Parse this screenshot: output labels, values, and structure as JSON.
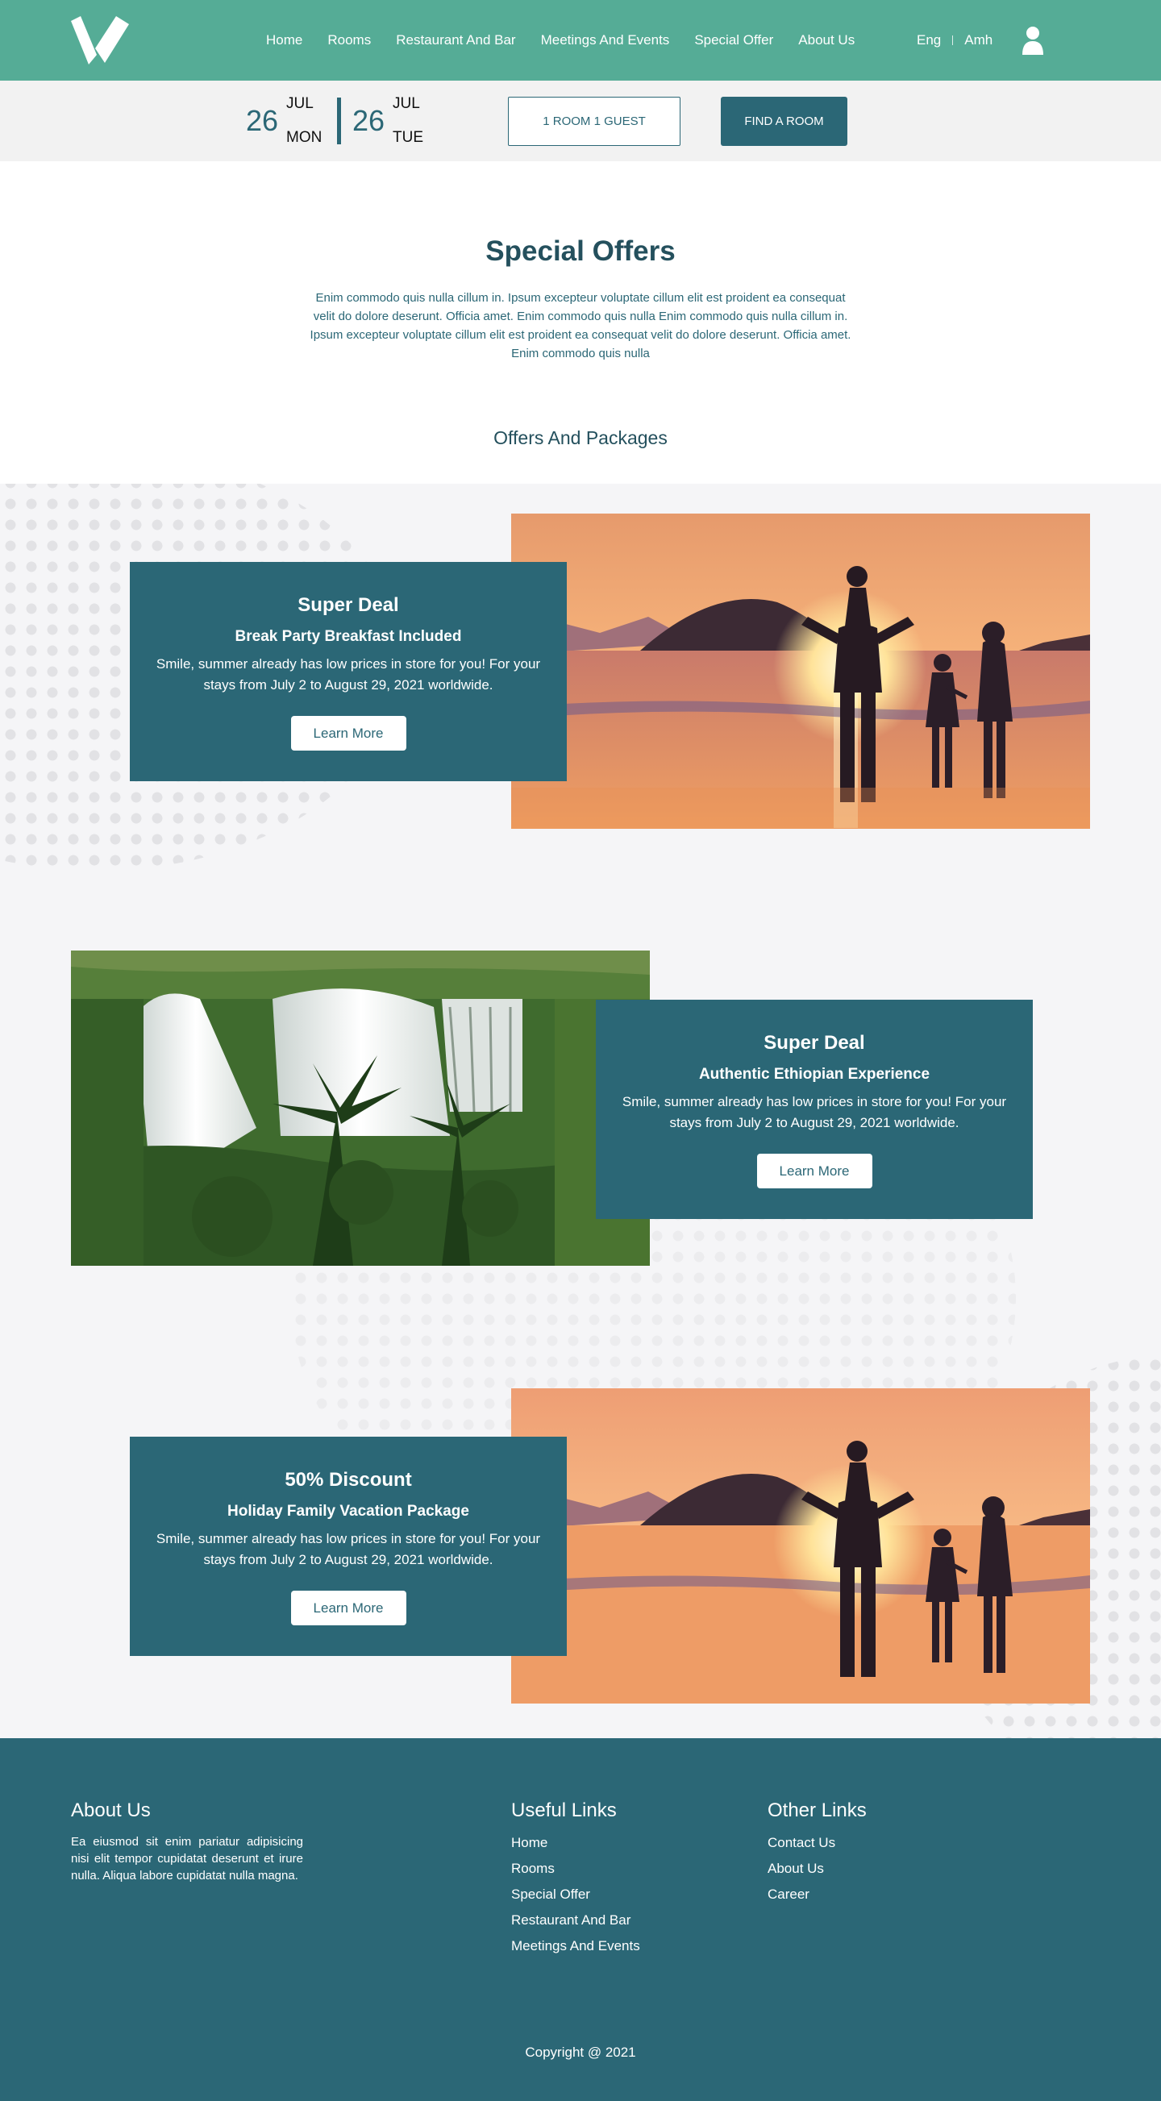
{
  "header": {
    "nav": [
      "Home",
      "Rooms",
      "Restaurant And Bar",
      "Meetings And Events",
      "Special Offer",
      "About Us"
    ],
    "lang": {
      "en": "Eng",
      "am": "Amh"
    },
    "icons": {
      "logo": "v-logo",
      "user": "user-icon"
    }
  },
  "booking": {
    "checkin": {
      "day": "26",
      "month": "JUL",
      "weekday": "MON"
    },
    "checkout": {
      "day": "26",
      "month": "JUL",
      "weekday": "TUE"
    },
    "guests_label": "1 ROOM 1 GUEST",
    "find_label": "FIND A ROOM"
  },
  "intro": {
    "title": "Special Offers",
    "text": "Enim commodo quis nulla cillum in. Ipsum excepteur voluptate cillum elit est proident ea consequat velit do dolore deserunt. Officia amet. Enim commodo quis nulla  Enim commodo quis nulla cillum in. Ipsum excepteur voluptate cillum elit est proident ea consequat velit do dolore deserunt. Officia amet. Enim commodo quis nulla",
    "subtitle": "Offers And Packages"
  },
  "offers": [
    {
      "title": "Super Deal",
      "subtitle": "Break Party Breakfast Included",
      "text": "Smile, summer already has low prices in store for you! For your stays from July 2 to August 29, 2021 worldwide.",
      "button": "Learn More"
    },
    {
      "title": "Super Deal",
      "subtitle": "Authentic Ethiopian Experience",
      "text": "Smile, summer already has low prices in store for you! For your stays from July 2 to August 29, 2021 worldwide.",
      "button": "Learn More"
    },
    {
      "title": "50% Discount",
      "subtitle": "Holiday Family Vacation Package",
      "text": "Smile, summer already has low prices in store for you! For your stays from July 2 to August 29, 2021 worldwide.",
      "button": "Learn More"
    }
  ],
  "footer": {
    "about_title": "About Us",
    "about_text": "Ea eiusmod sit enim pariatur adipisicing nisi elit tempor cupidatat deserunt et irure nulla. Aliqua labore cupidatat nulla magna.",
    "useful_title": "Useful Links",
    "useful_links": [
      "Home",
      "Rooms",
      "Special Offer",
      "Restaurant And Bar",
      "Meetings And Events"
    ],
    "other_title": "Other Links",
    "other_links": [
      "Contact Us",
      "About Us",
      "Career"
    ],
    "copyright": "Copyright @ 2021"
  },
  "colors": {
    "header": "#55ac96",
    "primary": "#2b6776",
    "booking_bg": "#f2f2f2",
    "offers_bg": "#f5f5f7"
  }
}
